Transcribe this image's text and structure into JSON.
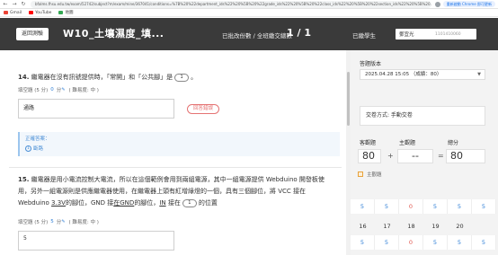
{
  "browser": {
    "url": "bfalms.fhsu.edu.tw/exam/52742/subject?m/exam/mine/367041/conditions=%7B%20%22department_ids%22%20%5B%20%22grade_ids%22%20%5B%20%22class_ids%22%20%5B%20%22section_ids%22%20%5B%20..."
  },
  "bookmarks": [
    {
      "label": "Gmail",
      "color": "#ea4335"
    },
    {
      "label": "YouTube",
      "color": "#ff0000"
    },
    {
      "label": "地圖",
      "color": "#34a853"
    }
  ],
  "chrome_pill": "重新啟動 Chrome 即可更新",
  "header": {
    "back_label": "返回測驗",
    "title": "W10_土壤濕度_填...",
    "answered_label": "已批改份數 / 全班繳交總數",
    "counter": "1 / 1",
    "student_label": "已繳學生",
    "student_name": "鄧宜光",
    "student_id": "1101410060"
  },
  "questions": [
    {
      "num": "14.",
      "text_before": "繼電器在沒有訊號提供時，「常開」和「公共腳」是",
      "blank": "1",
      "text_after": "。",
      "meta_label": "填空題 (5 分)",
      "score": "0",
      "unit": "分",
      "difficulty": "( 難易度: 中 )",
      "answer": "通路",
      "tag": "回答錯誤",
      "correct_title": "正確答案：",
      "correct_opt_num": "1",
      "correct_answer": "斷路"
    },
    {
      "num": "15.",
      "line1": "繼電器是用小電流控制大電流，所以在這個範例會用到兩組電源，其中一組電源提供 Webduino 開發板使",
      "line2": "用，另外一組電源則是供應繼電器使用，在繼電器上頭有紅增綠燈的一個，具有三個腳位，將 VCC 接在",
      "line3_a": "Webduino",
      "line3_b": "3.3V",
      "line3_c": "的腳位，GND 接",
      "line3_d": "在GND",
      "line3_e": "的腳位，",
      "line3_f": "IN",
      "line3_g": "接在",
      "blank": "1",
      "line3_h": "的位置",
      "meta_label": "填空題 (5 分)",
      "score": "5",
      "unit": "分",
      "difficulty": "( 難易度: 中 )",
      "answer": "5"
    }
  ],
  "side": {
    "version_label": "答題版本",
    "version_value": "2025.04.28 15:05 （成績：80）",
    "mode_label": "交卷方式: 手動交卷",
    "score_labels": [
      "客觀題",
      "主觀題",
      "總分"
    ],
    "objective": "80",
    "plus": "+",
    "subjective": "--",
    "equals": "=",
    "total": "80",
    "grid_label": "主觀題",
    "row_a_vals": [
      "5",
      "5",
      "0",
      "5",
      "5",
      "5"
    ],
    "row_b_nums": [
      "16",
      "17",
      "18",
      "19",
      "20",
      ""
    ],
    "row_c_vals": [
      "5",
      "5",
      "0",
      "5",
      "5",
      "5"
    ]
  }
}
